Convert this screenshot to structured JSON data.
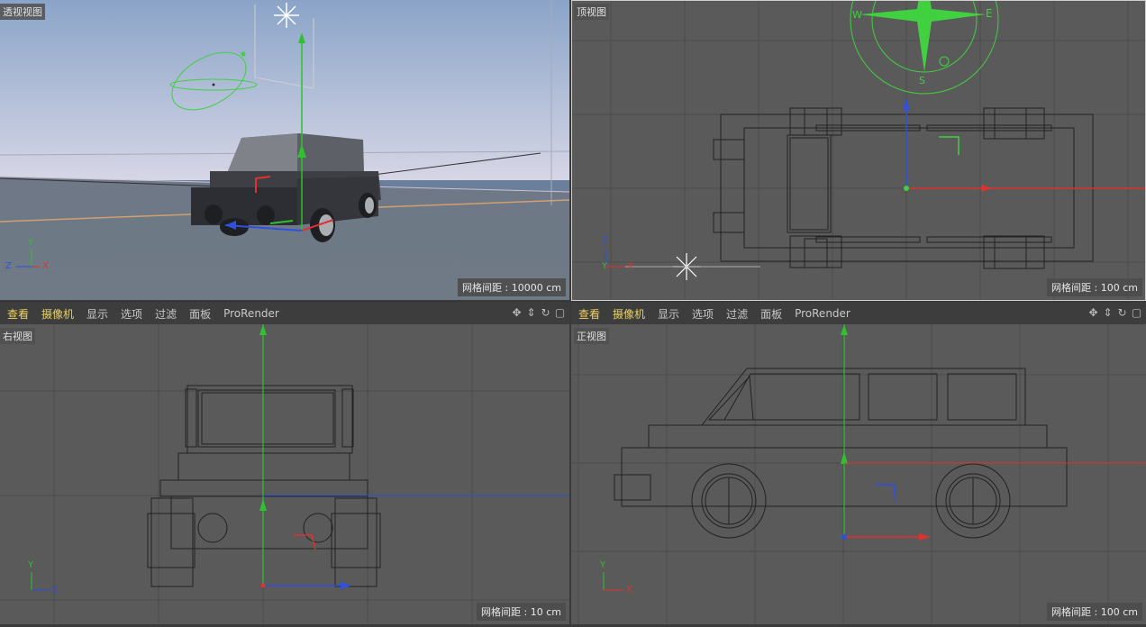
{
  "viewports": {
    "perspective": {
      "label": "透视视图",
      "grid": "网格间距 : 10000 cm"
    },
    "top": {
      "label": "顶视图",
      "grid": "网格间距 : 100 cm"
    },
    "right": {
      "label": "右视图",
      "grid": "网格间距 : 10 cm"
    },
    "front": {
      "label": "正视图",
      "grid": "网格间距 : 100 cm"
    }
  },
  "menu": [
    "查看",
    "摄像机",
    "显示",
    "选项",
    "过滤",
    "面板",
    "ProRender"
  ],
  "tool_icons": [
    "move-icon",
    "zoom-icon",
    "rotate-icon",
    "maximize-icon"
  ],
  "tool_glyphs": [
    "✥",
    "⇕",
    "↻",
    "▢"
  ],
  "axis_labels": {
    "x": "X",
    "y": "Y",
    "z": "Z"
  },
  "compass": {
    "w": "W",
    "e": "E",
    "s": "S"
  },
  "colors": {
    "x_axis": "#e03030",
    "y_axis": "#30c030",
    "z_axis": "#3050e0",
    "menu_active": "#f2cf5b",
    "light_green": "#40d040"
  }
}
